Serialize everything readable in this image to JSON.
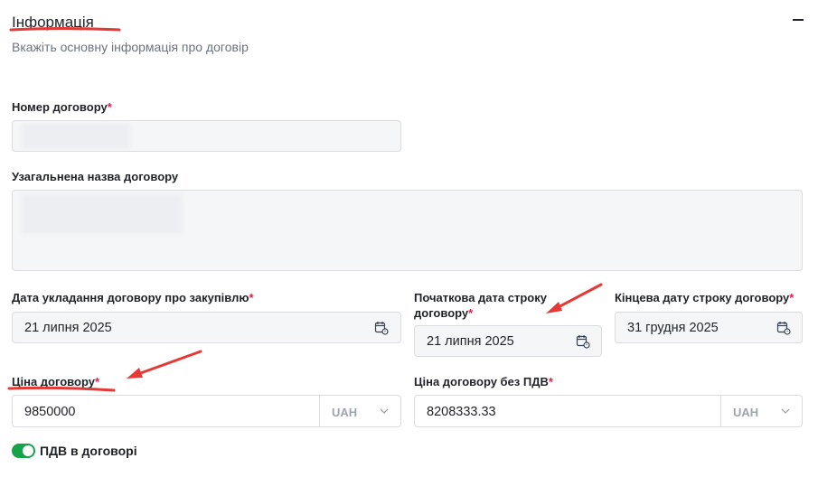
{
  "section": {
    "title": "Інформація",
    "subtitle": "Вкажіть основну інформація про договір"
  },
  "fields": {
    "contract_number": {
      "label": "Номер договору",
      "required_mark": "*"
    },
    "contract_name": {
      "label": "Узагальнена назва договору"
    },
    "conclusion_date": {
      "label": "Дата укладання договору про закупівлю",
      "required_mark": "*",
      "value": "21 липня 2025"
    },
    "start_date": {
      "label_line1": "Початкова дата строку",
      "label_line2": "договору",
      "required_mark": "*",
      "value": "21 липня 2025"
    },
    "end_date": {
      "label": "Кінцева дату строку договору",
      "required_mark": "*",
      "value": "31 грудня 2025"
    },
    "price": {
      "label": "Ціна договору",
      "required_mark": "*",
      "value": "9850000",
      "currency": "UAH"
    },
    "price_no_vat": {
      "label": "Ціна договору без ПДВ",
      "required_mark": "*",
      "value": "8208333.33",
      "currency": "UAH"
    }
  },
  "vat_toggle": {
    "label": "ПДВ в договорі",
    "on": true
  },
  "icons": {
    "collapse": "minus-icon",
    "calendar": "calendar-icon",
    "dropdown": "chevron-down-icon"
  },
  "colors": {
    "required": "#e11d48",
    "toggle_on": "#16a34a",
    "annotation": "#e53935"
  }
}
